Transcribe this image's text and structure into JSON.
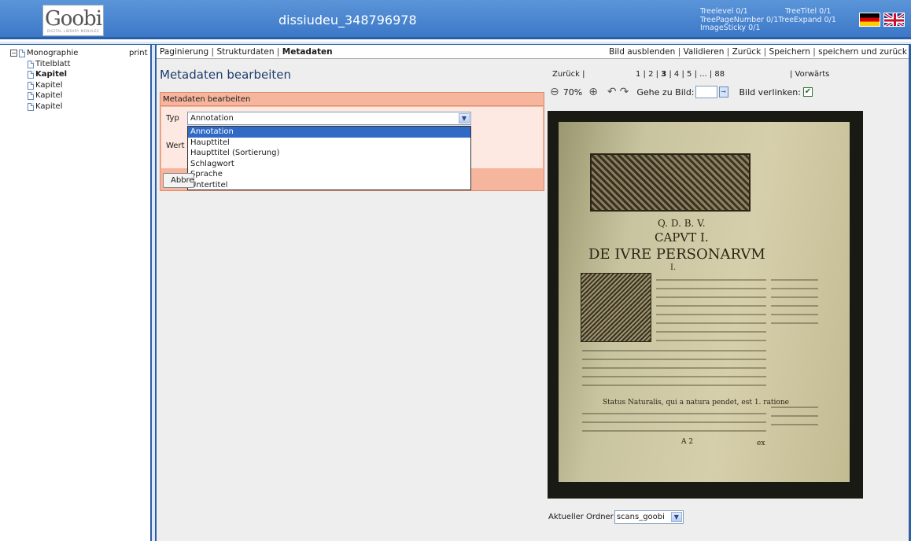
{
  "header": {
    "logo_text": "Goobi",
    "logo_subtext": "DIGITAL LIBRARY MODULES",
    "process_title": "dissiudeu_348796978",
    "tree_info": {
      "treelevel": "Treelevel 0/1",
      "treetitel": "TreeTitel 0/1",
      "treepagenumber": "TreePageNumber 0/1",
      "treeexpand": "TreeExpand 0/1",
      "imagesticky": "ImageSticky 0/1"
    },
    "flags": [
      "flag-de-icon",
      "flag-uk-icon"
    ]
  },
  "tree": {
    "print_label": "print",
    "root": "Monographie",
    "children": [
      "Titelblatt",
      "Kapitel",
      "Kapitel",
      "Kapitel",
      "Kapitel"
    ]
  },
  "toolbar": {
    "left": [
      "Paginierung",
      "Strukturdaten",
      "Metadaten"
    ],
    "right": [
      "Bild ausblenden",
      "Validieren",
      "Zurück",
      "Speichern",
      "speichern und zurück"
    ]
  },
  "editor": {
    "page_title": "Metadaten bearbeiten",
    "box_title": "Metadaten bearbeiten",
    "typ_label": "Typ",
    "wert_label": "Wert",
    "typ_selected": "Annotation",
    "typ_options": [
      "Annotation",
      "Haupttitel",
      "Haupttitel (Sortierung)",
      "Schlagwort",
      "Sprache",
      "Untertitel"
    ],
    "abort_button": "Abbrechen"
  },
  "image_nav": {
    "back": "Zurück |",
    "pages": "1 | 2 | 3 | 4 | 5 | ... | 88",
    "current_page": "3",
    "forward": "| Vorwärts",
    "zoom": "70%",
    "goto_label": "Gehe zu Bild:",
    "link_label": "Bild verlinken:",
    "link_checked": true
  },
  "scan": {
    "header_line": "Q. D. B. V.",
    "caput": "CAPVT I.",
    "title": "DE IVRE PERSONARVM",
    "numeral": "I.",
    "status_line": "Status Naturalis, qui a natura pendet, est 1. ratione",
    "page_sig": "A 2",
    "catchword": "ex"
  },
  "folder": {
    "label": "Aktueller Ordner",
    "value": "scans_goobi"
  },
  "colors": {
    "header_blue": "#3c78c8",
    "panel_salmon": "#f6b59d",
    "selection_blue": "#316ac5"
  }
}
